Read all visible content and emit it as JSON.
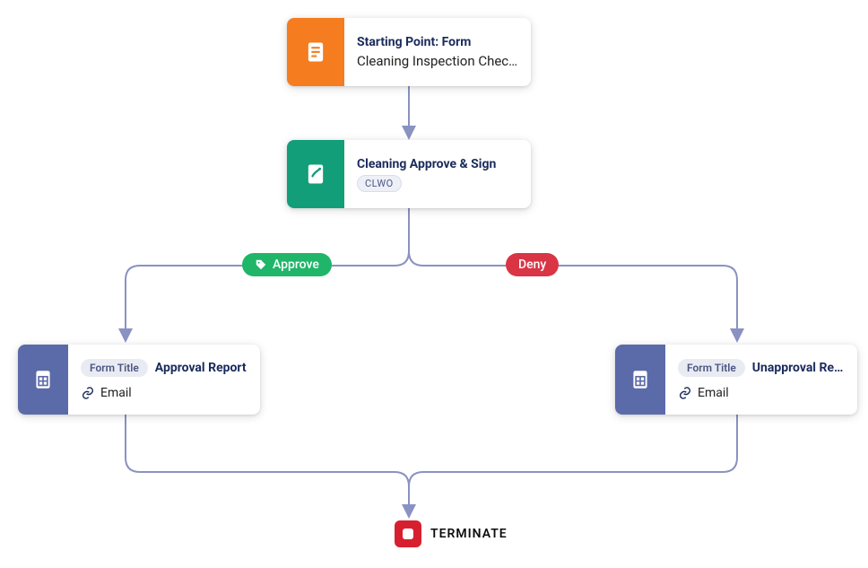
{
  "nodes": {
    "start": {
      "title": "Starting Point: Form",
      "subtitle": "Cleaning Inspection Chec…",
      "accent": "#f57c1f"
    },
    "approveSign": {
      "title": "Cleaning Approve & Sign",
      "tag": "CLWO",
      "accent": "#129e78"
    },
    "approvalReport": {
      "chip": "Form Title",
      "name": "Approval Report",
      "channel": "Email",
      "accent": "#5b6aa8"
    },
    "unapprovalReport": {
      "chip": "Form Title",
      "name": "Unapproval Re…",
      "channel": "Email",
      "accent": "#5b6aa8"
    }
  },
  "branches": {
    "approve": {
      "label": "Approve",
      "color": "#1fb669"
    },
    "deny": {
      "label": "Deny",
      "color": "#d93545"
    }
  },
  "terminate": {
    "label": "TERMINATE"
  }
}
